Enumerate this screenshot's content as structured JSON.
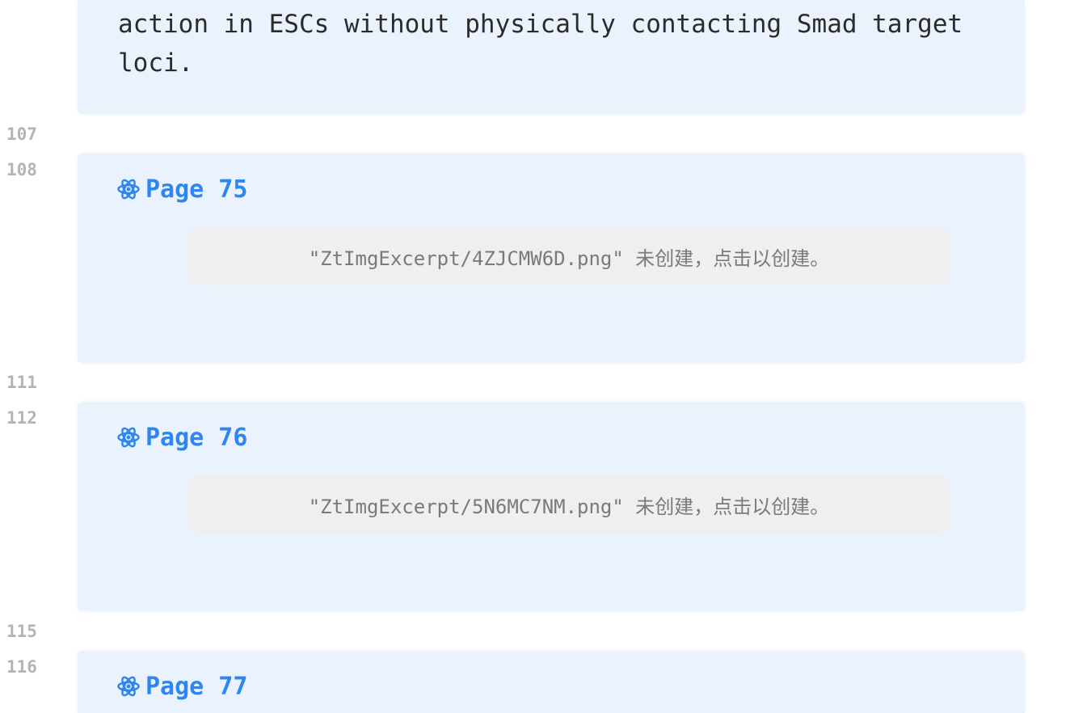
{
  "top_callout": {
    "text": "action in ESCs without physically contacting Smad target\nloci."
  },
  "line_numbers": {
    "n107": "107",
    "n108": "108",
    "n111": "111",
    "n112": "112",
    "n115": "115",
    "n116": "116"
  },
  "callouts": [
    {
      "title": "Page 75",
      "icon": "atom-icon",
      "embed_text": "\"ZtImgExcerpt/4ZJCMW6D.png\" 未创建，点击以创建。"
    },
    {
      "title": "Page 76",
      "icon": "atom-icon",
      "embed_text": "\"ZtImgExcerpt/5N6MC7NM.png\" 未创建，点击以创建。"
    },
    {
      "title": "Page 77",
      "icon": "atom-icon"
    }
  ],
  "colors": {
    "callout_bg": "#eaf2fd",
    "title_blue": "#2f86f0",
    "line_number_gray": "#b4b4b4",
    "placeholder_bg": "#efefef"
  }
}
